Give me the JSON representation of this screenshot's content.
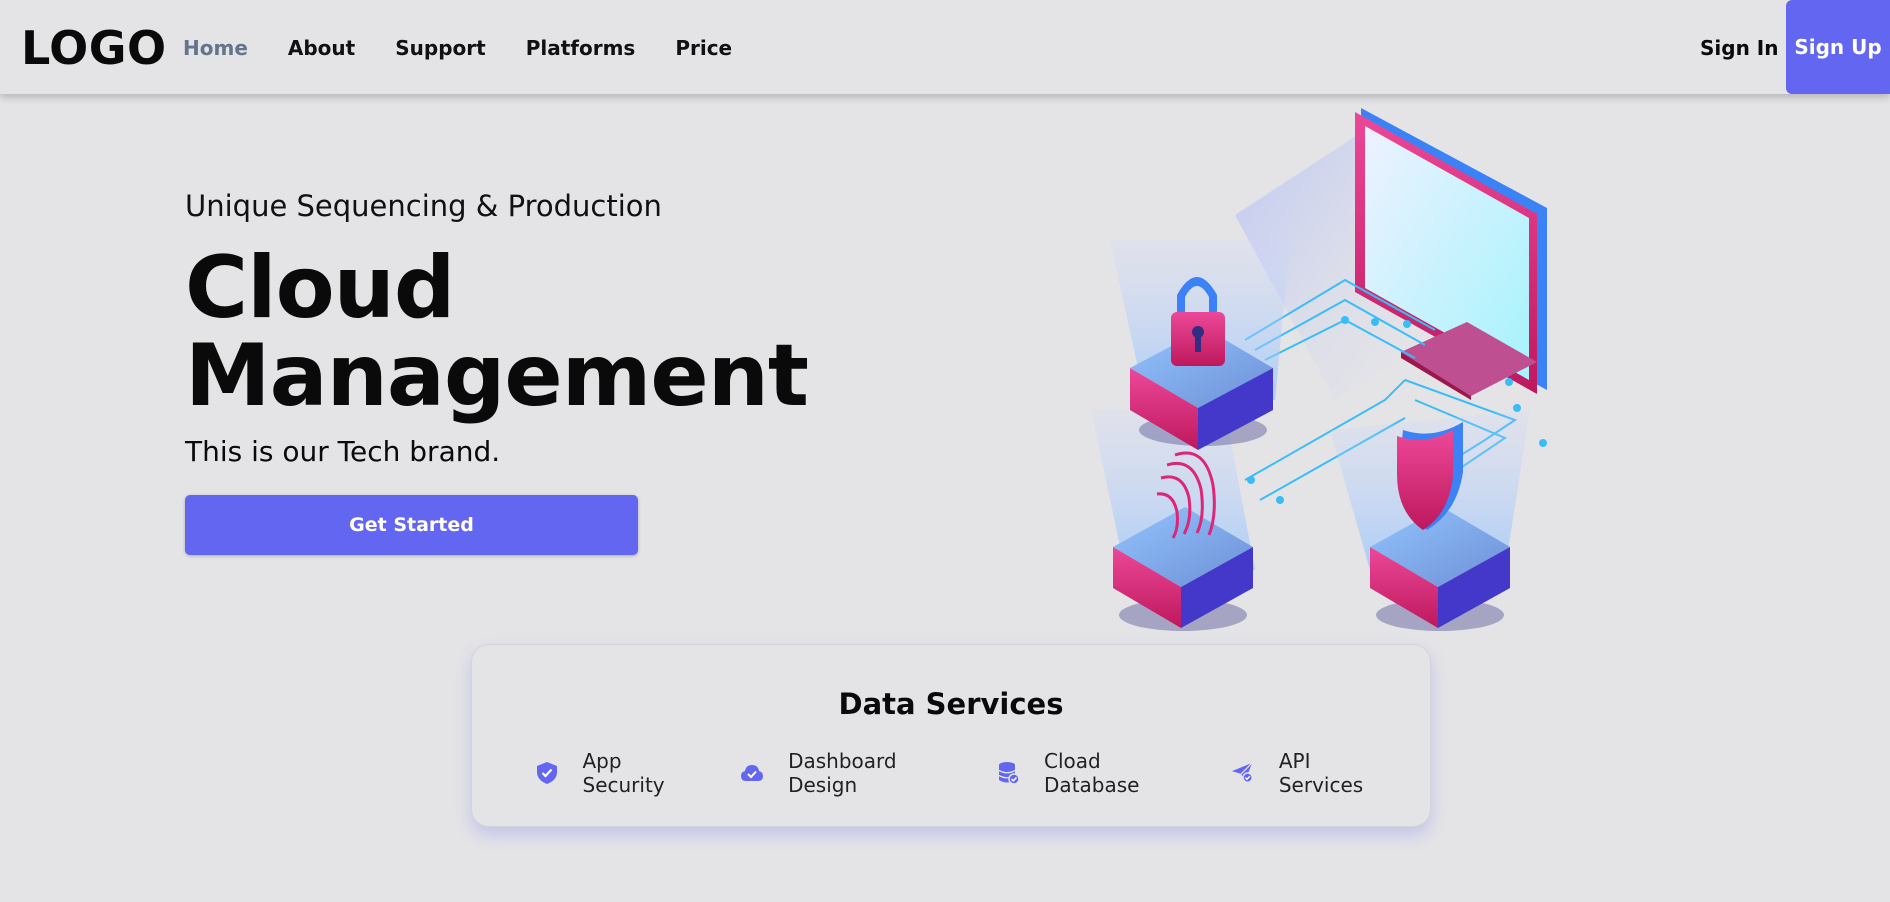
{
  "nav": {
    "logo": "LOGO",
    "links": [
      "Home",
      "About",
      "Support",
      "Platforms",
      "Price"
    ],
    "active": "Home",
    "sign_in": "Sign In",
    "sign_up": "Sign Up"
  },
  "hero": {
    "eyebrow": "Unique Sequencing & Production",
    "title_line1": "Cloud",
    "title_line2": "Management",
    "tagline": "This is our Tech brand.",
    "cta": "Get Started"
  },
  "services": {
    "title": "Data Services",
    "items": [
      {
        "label": "App Security",
        "icon": "shield-check-icon"
      },
      {
        "label": "Dashboard Design",
        "icon": "cloud-check-icon"
      },
      {
        "label": "Cload Database",
        "icon": "database-check-icon"
      },
      {
        "label": "API Services",
        "icon": "paper-plane-check-icon"
      }
    ]
  },
  "colors": {
    "accent": "#6366f1",
    "background": "#e4e4e7",
    "active_link": "#64748b"
  }
}
